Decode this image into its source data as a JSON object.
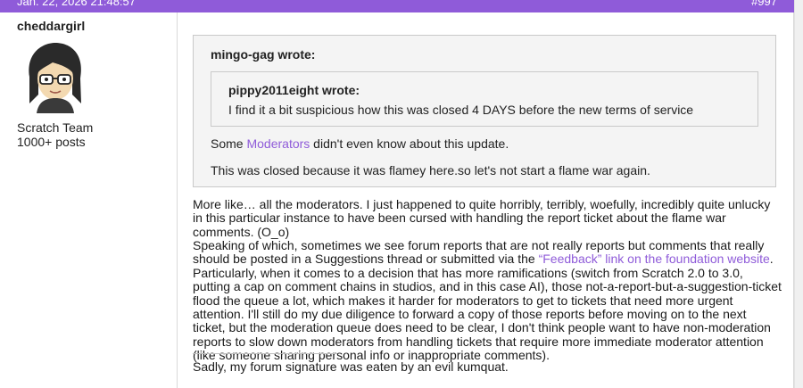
{
  "post": {
    "timestamp": "Jan. 22, 2026 21:48:57",
    "number": "#997"
  },
  "author": {
    "username": "cheddargirl",
    "role": "Scratch Team",
    "post_count": "1000+ posts"
  },
  "outer_quote": {
    "author_line": "mingo-gag wrote:",
    "inner_quote": {
      "author_line": "pippy2011eight wrote:",
      "text": "I find it a bit suspicious how this was closed 4 DAYS before the new terms of service"
    },
    "line1_before": "Some ",
    "line1_link": "Moderators",
    "line1_after": " didn't even know about this update.",
    "line2": "This was closed because it was flamey here.so let's not start a flame war again."
  },
  "body": {
    "para1": "More like… all the moderators. I just happened to quite horribly, terribly, woefully, incredibly quite unlucky in this particular instance to have been cursed with handling the report ticket about the flame war comments. (O_o)",
    "para2_before": "Speaking of which, sometimes we see forum reports that are not really reports but comments that really should be posted in a Suggestions thread or submitted via the ",
    "para2_link": "“Feedback” link on the foundation website",
    "para2_after": ". Particularly, when it comes to a decision that has more ramifications (switch from Scratch 2.0 to 3.0, putting a cap on comment chains in studios, and in this case AI), those not-a-report-but-a-suggestion-ticket flood the queue a lot, which makes it harder for moderators to get to tickets that need more urgent attention. I'll still do my due diligence to forward a copy of those reports before moving on to the next ticket, but the moderation queue does need to be clear, I don't think people want to have non-moderation reports to slow down moderators from handling tickets that require more immediate moderator attention (like someone sharing personal info or inappropriate comments)."
  },
  "signature": "Sadly, my forum signature was eaten by an evil kumquat.",
  "colors": {
    "header": "#8f5bd9",
    "link": "#8f5bd9",
    "quote_bg": "#f4f4f4",
    "quote_border": "#c9c9c9"
  }
}
